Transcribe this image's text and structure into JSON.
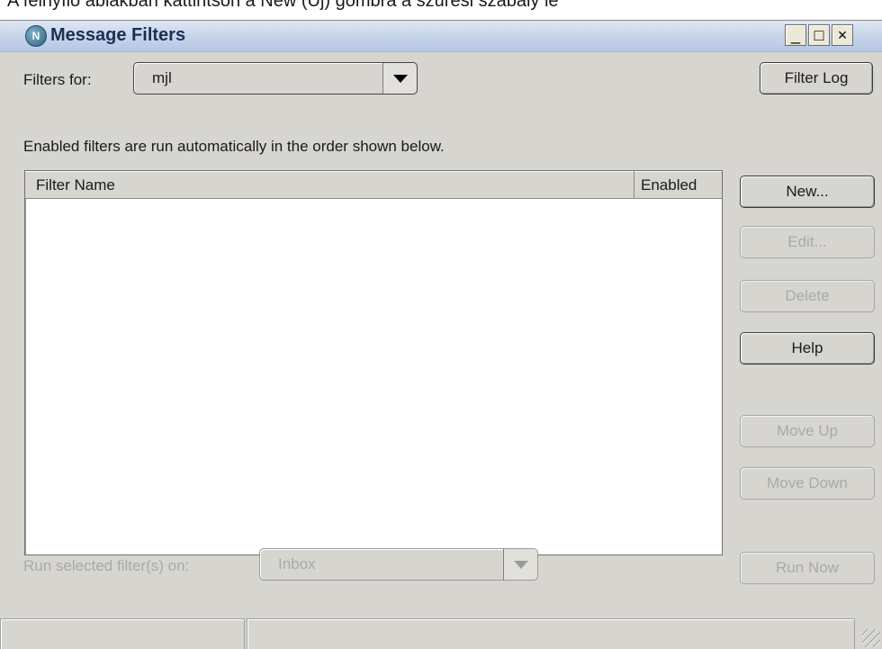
{
  "caption": "A felnyíló ablakban kattintson a New (Új) gombra a szűrési szabály lé",
  "window": {
    "title": "Message Filters",
    "app_icon_glyph": "N",
    "controls": {
      "minimize": "_",
      "maximize": "□",
      "close": "×"
    }
  },
  "filters_for": {
    "label": "Filters for:",
    "value": "mjl"
  },
  "filter_log_button": "Filter Log",
  "info_text": "Enabled filters are run automatically in the order shown below.",
  "list": {
    "columns": [
      "Filter Name",
      "Enabled"
    ],
    "rows": []
  },
  "buttons": {
    "new": "New...",
    "edit": "Edit...",
    "delete": "Delete",
    "help": "Help",
    "move_up": "Move Up",
    "move_down": "Move Down",
    "run_now": "Run Now"
  },
  "run_selected": {
    "label": "Run selected filter(s) on:",
    "value": "Inbox"
  },
  "icons": [
    "app-icon",
    "minimize-icon",
    "maximize-icon",
    "close-icon",
    "dropdown-arrow-icon",
    "resize-grip-icon"
  ]
}
